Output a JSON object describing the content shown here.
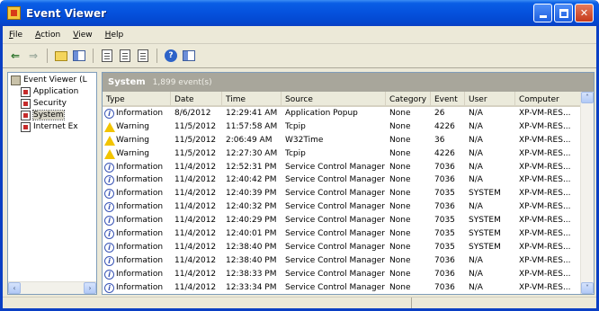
{
  "window": {
    "title": "Event Viewer"
  },
  "menu": [
    {
      "label": "File",
      "key": "F",
      "rest": "ile"
    },
    {
      "label": "Action",
      "key": "A",
      "rest": "ction"
    },
    {
      "label": "View",
      "key": "V",
      "rest": "iew"
    },
    {
      "label": "Help",
      "key": "H",
      "rest": "elp"
    }
  ],
  "toolbar": {
    "icons": [
      "back-arrow-icon",
      "forward-arrow-icon",
      "up-folder-icon",
      "show-hide-pane-icon",
      "export-list-icon",
      "properties-icon",
      "refresh-icon",
      "help-icon",
      "pane-view-icon"
    ]
  },
  "tree": {
    "root": "Event Viewer (L",
    "items": [
      "Application",
      "Security",
      "System",
      "Internet Ex"
    ],
    "selected": "System"
  },
  "list": {
    "log_name": "System",
    "event_count": "1,899 event(s)",
    "columns": [
      "Type",
      "Date",
      "Time",
      "Source",
      "Category",
      "Event",
      "User",
      "Computer"
    ],
    "rows": [
      {
        "type": "Information",
        "date": "8/6/2012",
        "time": "12:29:41 AM",
        "source": "Application Popup",
        "category": "None",
        "event": "26",
        "user": "N/A",
        "computer": "XP-VM-RES..."
      },
      {
        "type": "Warning",
        "date": "11/5/2012",
        "time": "11:57:58 AM",
        "source": "Tcpip",
        "category": "None",
        "event": "4226",
        "user": "N/A",
        "computer": "XP-VM-RES..."
      },
      {
        "type": "Warning",
        "date": "11/5/2012",
        "time": "2:06:49 AM",
        "source": "W32Time",
        "category": "None",
        "event": "36",
        "user": "N/A",
        "computer": "XP-VM-RES..."
      },
      {
        "type": "Warning",
        "date": "11/5/2012",
        "time": "12:27:30 AM",
        "source": "Tcpip",
        "category": "None",
        "event": "4226",
        "user": "N/A",
        "computer": "XP-VM-RES..."
      },
      {
        "type": "Information",
        "date": "11/4/2012",
        "time": "12:52:31 PM",
        "source": "Service Control Manager",
        "category": "None",
        "event": "7036",
        "user": "N/A",
        "computer": "XP-VM-RES..."
      },
      {
        "type": "Information",
        "date": "11/4/2012",
        "time": "12:40:42 PM",
        "source": "Service Control Manager",
        "category": "None",
        "event": "7036",
        "user": "N/A",
        "computer": "XP-VM-RES..."
      },
      {
        "type": "Information",
        "date": "11/4/2012",
        "time": "12:40:39 PM",
        "source": "Service Control Manager",
        "category": "None",
        "event": "7035",
        "user": "SYSTEM",
        "computer": "XP-VM-RES..."
      },
      {
        "type": "Information",
        "date": "11/4/2012",
        "time": "12:40:32 PM",
        "source": "Service Control Manager",
        "category": "None",
        "event": "7036",
        "user": "N/A",
        "computer": "XP-VM-RES..."
      },
      {
        "type": "Information",
        "date": "11/4/2012",
        "time": "12:40:29 PM",
        "source": "Service Control Manager",
        "category": "None",
        "event": "7035",
        "user": "SYSTEM",
        "computer": "XP-VM-RES..."
      },
      {
        "type": "Information",
        "date": "11/4/2012",
        "time": "12:40:01 PM",
        "source": "Service Control Manager",
        "category": "None",
        "event": "7035",
        "user": "SYSTEM",
        "computer": "XP-VM-RES..."
      },
      {
        "type": "Information",
        "date": "11/4/2012",
        "time": "12:38:40 PM",
        "source": "Service Control Manager",
        "category": "None",
        "event": "7035",
        "user": "SYSTEM",
        "computer": "XP-VM-RES..."
      },
      {
        "type": "Information",
        "date": "11/4/2012",
        "time": "12:38:40 PM",
        "source": "Service Control Manager",
        "category": "None",
        "event": "7036",
        "user": "N/A",
        "computer": "XP-VM-RES..."
      },
      {
        "type": "Information",
        "date": "11/4/2012",
        "time": "12:38:33 PM",
        "source": "Service Control Manager",
        "category": "None",
        "event": "7036",
        "user": "N/A",
        "computer": "XP-VM-RES..."
      },
      {
        "type": "Information",
        "date": "11/4/2012",
        "time": "12:33:34 PM",
        "source": "Service Control Manager",
        "category": "None",
        "event": "7036",
        "user": "N/A",
        "computer": "XP-VM-RES..."
      }
    ]
  }
}
